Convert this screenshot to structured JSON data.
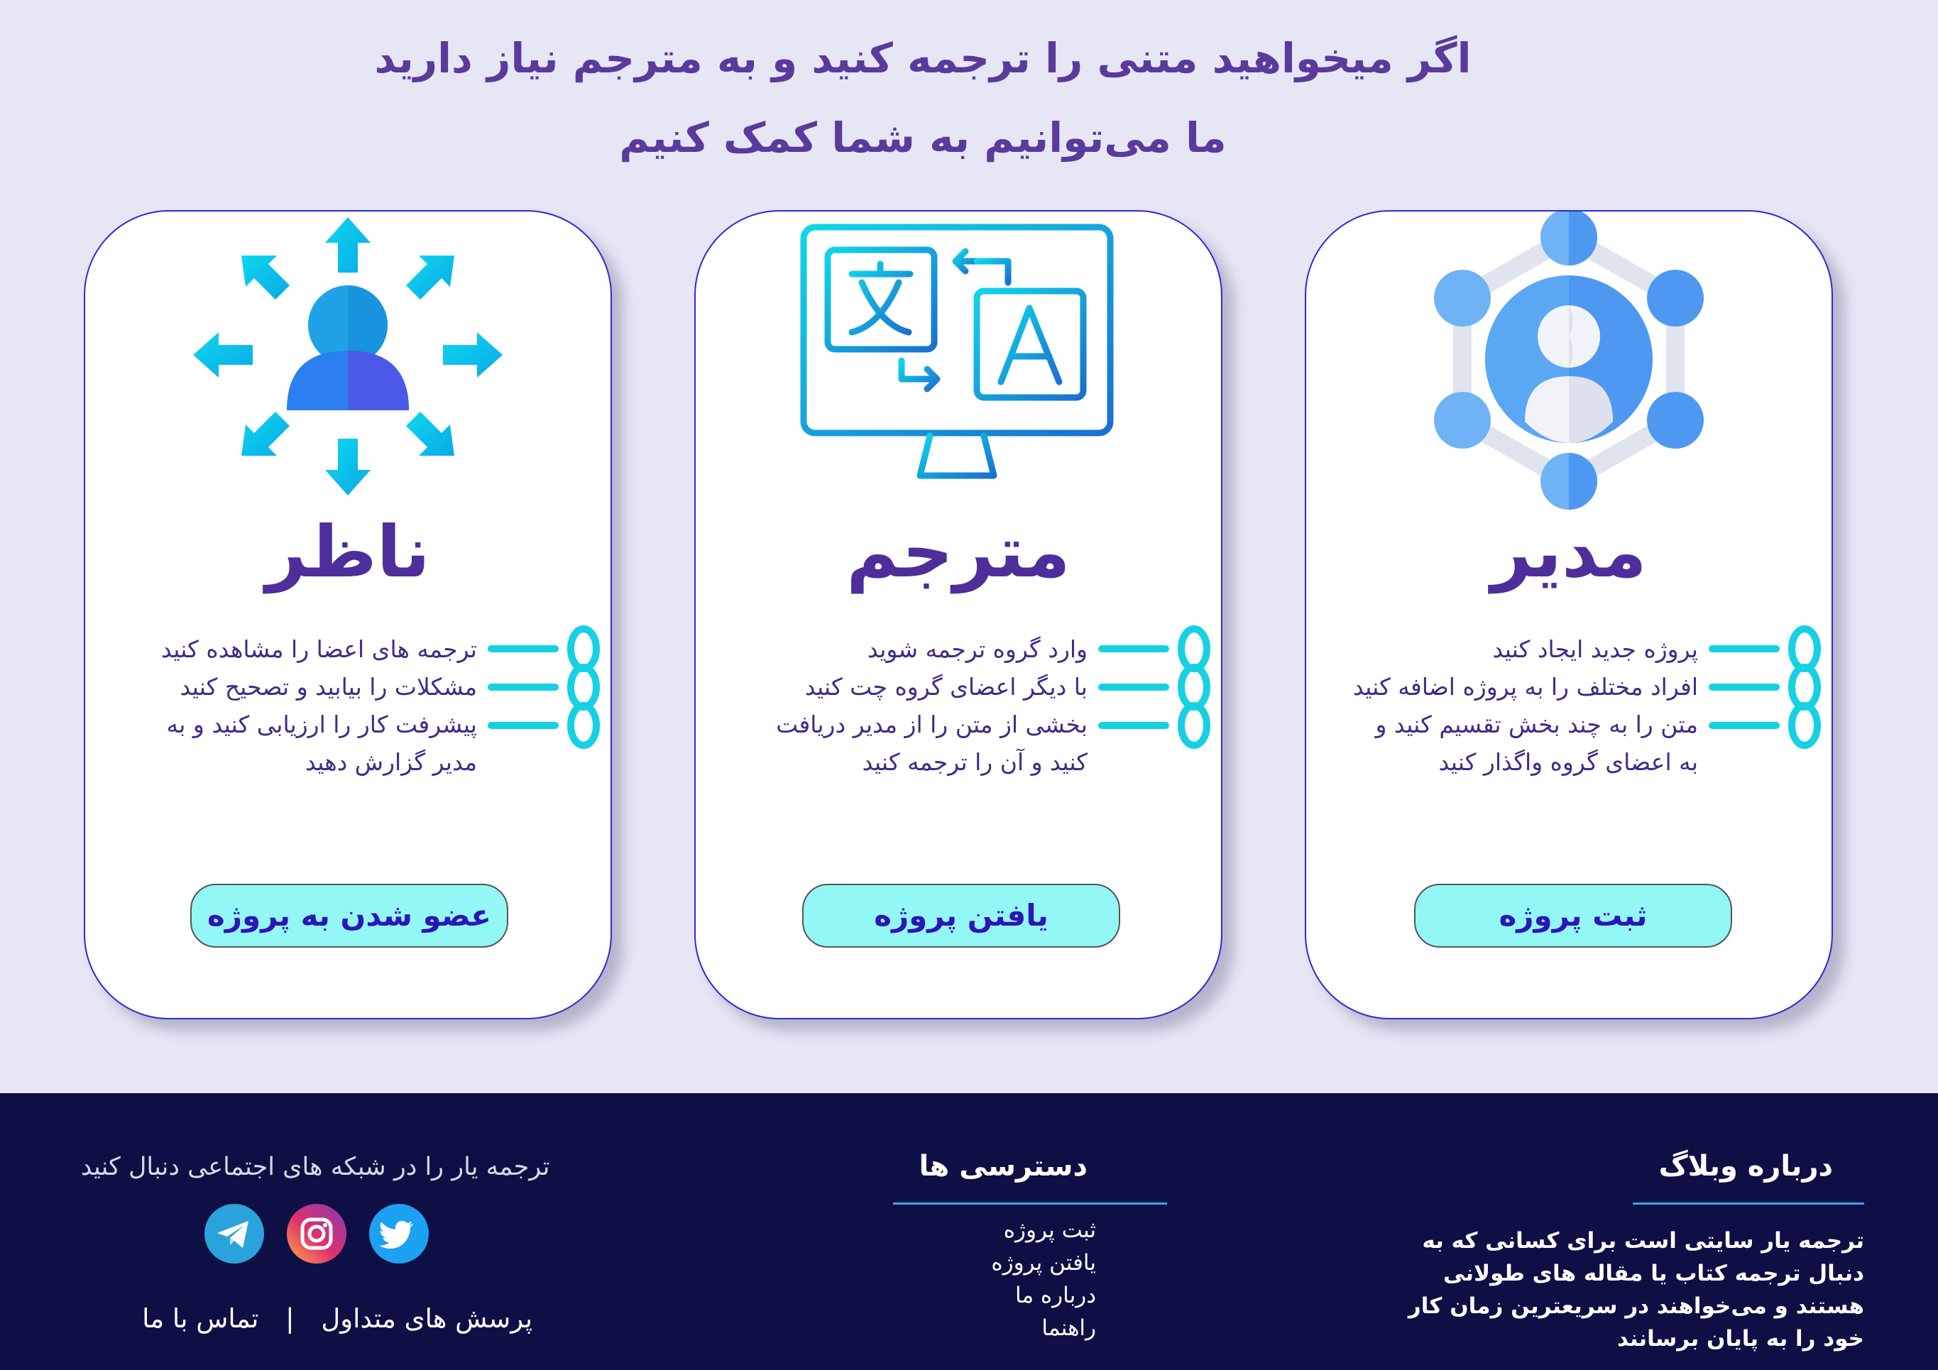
{
  "header": {
    "line1": "اگر میخواهید متنی را ترجمه کنید و به مترجم نیاز دارید",
    "line2": "ما می‌توانیم به شما کمک کنیم"
  },
  "cards": [
    {
      "title": "مدیر",
      "icon": "manager-network-icon",
      "desc": [
        "پروژه جدید ایجاد کنید",
        "افراد مختلف را به پروژه اضافه کنید",
        "متن را به چند بخش تقسیم کنید و",
        "به اعضای گروه واگذار کنید"
      ],
      "button": "ثبت پروژه"
    },
    {
      "title": "مترجم",
      "icon": "translate-monitor-icon",
      "desc": [
        "وارد گروه ترجمه شوید",
        "با دیگر اعضای گروه چت کنید",
        "بخشی از متن را از مدیر دریافت",
        "کنید و آن را ترجمه کنید"
      ],
      "button": "یافتن پروژه"
    },
    {
      "title": "ناظر",
      "icon": "supervisor-arrows-icon",
      "desc": [
        "ترجمه های اعضا را مشاهده کنید",
        "مشکلات را بیابید و تصحیح کنید",
        "پیشرفت کار را ارزیابی کنید و به",
        "مدیر گزارش دهید"
      ],
      "button": "عضو شدن به پروژه"
    }
  ],
  "footer": {
    "about": {
      "title": "درباره وبلاگ",
      "text": "ترجمه یار سایتی است برای کسانی که به دنبال ترجمه کتاب یا مقاله های طولانی هستند و می‌خواهند در سریعترین زمان کار خود را به پایان برسانند"
    },
    "access": {
      "title": "دسترسی ها",
      "links": [
        "ثبت پروژه",
        "یافتن پروژه",
        "درباره ما",
        "راهنما"
      ]
    },
    "social": {
      "text": "ترجمه یار را در شبکه های اجتماعی دنبال کنید",
      "icons": [
        "twitter-icon",
        "instagram-icon",
        "telegram-icon"
      ]
    },
    "bottom_links": {
      "faq": "پرسش های متداول",
      "separator": "|",
      "contact": "تماس با ما"
    }
  },
  "colors": {
    "page_bg": "#e7e6f5",
    "title_purple": "#4d2e9a",
    "card_border": "#2d2ad6",
    "button_bg": "#92f7f5",
    "button_text": "#2d15b9",
    "footer_bg": "#0e0f44",
    "accent_line": "#3aa6f0",
    "link_icon": "#16d0e3"
  }
}
